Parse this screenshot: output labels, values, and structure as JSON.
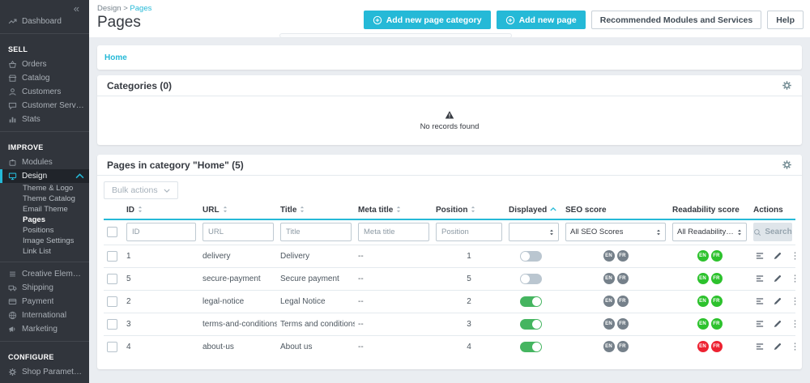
{
  "sidebar": {
    "collapse_icon": "«",
    "items": [
      {
        "type": "item",
        "label": "Dashboard",
        "icon": "dashboard"
      },
      {
        "type": "divider"
      },
      {
        "type": "section",
        "label": "SELL"
      },
      {
        "type": "item",
        "label": "Orders",
        "icon": "orders"
      },
      {
        "type": "item",
        "label": "Catalog",
        "icon": "catalog"
      },
      {
        "type": "item",
        "label": "Customers",
        "icon": "customers"
      },
      {
        "type": "item",
        "label": "Customer Service",
        "icon": "customer-service"
      },
      {
        "type": "item",
        "label": "Stats",
        "icon": "stats"
      },
      {
        "type": "divider"
      },
      {
        "type": "section",
        "label": "IMPROVE"
      },
      {
        "type": "item",
        "label": "Modules",
        "icon": "modules"
      },
      {
        "type": "item",
        "label": "Design",
        "icon": "design",
        "active": true,
        "expanded": true
      },
      {
        "type": "subitem",
        "label": "Theme & Logo"
      },
      {
        "type": "subitem",
        "label": "Theme Catalog"
      },
      {
        "type": "subitem",
        "label": "Email Theme"
      },
      {
        "type": "subitem",
        "label": "Pages",
        "active": true
      },
      {
        "type": "subitem",
        "label": "Positions"
      },
      {
        "type": "subitem",
        "label": "Image Settings"
      },
      {
        "type": "subitem",
        "label": "Link List"
      },
      {
        "type": "divider"
      },
      {
        "type": "item",
        "label": "Creative Elements",
        "icon": "creative-elements"
      },
      {
        "type": "item",
        "label": "Shipping",
        "icon": "shipping"
      },
      {
        "type": "item",
        "label": "Payment",
        "icon": "payment"
      },
      {
        "type": "item",
        "label": "International",
        "icon": "international"
      },
      {
        "type": "item",
        "label": "Marketing",
        "icon": "marketing"
      },
      {
        "type": "divider"
      },
      {
        "type": "section",
        "label": "CONFIGURE"
      },
      {
        "type": "item",
        "label": "Shop Parameters",
        "icon": "shop-parameters"
      }
    ]
  },
  "header": {
    "breadcrumb": {
      "parent": "Design",
      "separator": ">",
      "current": "Pages"
    },
    "title": "Pages",
    "buttons": [
      {
        "label": "Add new page category",
        "style": "primary",
        "icon": "plus-circle"
      },
      {
        "label": "Add new page",
        "style": "primary",
        "icon": "plus-circle"
      },
      {
        "label": "Recommended Modules and Services",
        "style": "outline"
      },
      {
        "label": "Help",
        "style": "outline"
      }
    ]
  },
  "breadcrumb_card": {
    "link": "Home"
  },
  "categories_panel": {
    "title": "Categories (0)",
    "empty_text": "No records found",
    "empty_icon": "warning",
    "settings_icon": "gear"
  },
  "pages_panel": {
    "title": "Pages in category \"Home\" (5)",
    "settings_icon": "gear",
    "bulk_actions_label": "Bulk actions",
    "columns": [
      {
        "label": "",
        "key": "select"
      },
      {
        "label": "ID",
        "key": "id",
        "sortable": true
      },
      {
        "label": "URL",
        "key": "url",
        "sortable": true
      },
      {
        "label": "Title",
        "key": "title",
        "sortable": true
      },
      {
        "label": "Meta title",
        "key": "meta_title",
        "sortable": true
      },
      {
        "label": "Position",
        "key": "position",
        "sortable": true
      },
      {
        "label": "Displayed",
        "key": "displayed",
        "sortable": true,
        "sorted": "asc"
      },
      {
        "label": "SEO score",
        "key": "seo"
      },
      {
        "label": "Readability score",
        "key": "readability"
      },
      {
        "label": "Actions",
        "key": "actions"
      }
    ],
    "filters": {
      "id_placeholder": "ID",
      "url_placeholder": "URL",
      "title_placeholder": "Title",
      "meta_title_placeholder": "Meta title",
      "position_placeholder": "Position",
      "displayed_value": "",
      "seo_value": "All SEO Scores",
      "readability_value": "All Readability Score",
      "search_label": "Search"
    },
    "languages": [
      "EN",
      "FR"
    ],
    "rows": [
      {
        "id": "1",
        "url": "delivery",
        "title": "Delivery",
        "meta_title": "--",
        "position": "1",
        "displayed": false,
        "seo_score": "neutral",
        "readability_score": "good"
      },
      {
        "id": "5",
        "url": "secure-payment",
        "title": "Secure payment",
        "meta_title": "--",
        "position": "5",
        "displayed": false,
        "seo_score": "neutral",
        "readability_score": "good"
      },
      {
        "id": "2",
        "url": "legal-notice",
        "title": "Legal Notice",
        "meta_title": "--",
        "position": "2",
        "displayed": true,
        "seo_score": "neutral",
        "readability_score": "good"
      },
      {
        "id": "3",
        "url": "terms-and-conditions-of-use",
        "title": "Terms and conditions of use",
        "meta_title": "--",
        "position": "3",
        "displayed": true,
        "seo_score": "neutral",
        "readability_score": "good"
      },
      {
        "id": "4",
        "url": "about-us",
        "title": "About us",
        "meta_title": "--",
        "position": "4",
        "displayed": true,
        "seo_score": "neutral",
        "readability_score": "bad"
      }
    ],
    "row_actions": [
      {
        "icon": "preview"
      },
      {
        "icon": "edit"
      },
      {
        "icon": "more-menu"
      }
    ]
  },
  "colors": {
    "accent": "#25b9d7",
    "toggle_on": "#45b560",
    "toggle_off": "#bac6d0",
    "badge_neutral": "#75808a",
    "badge_good": "#2dc22d",
    "badge_bad": "#ed2231"
  }
}
